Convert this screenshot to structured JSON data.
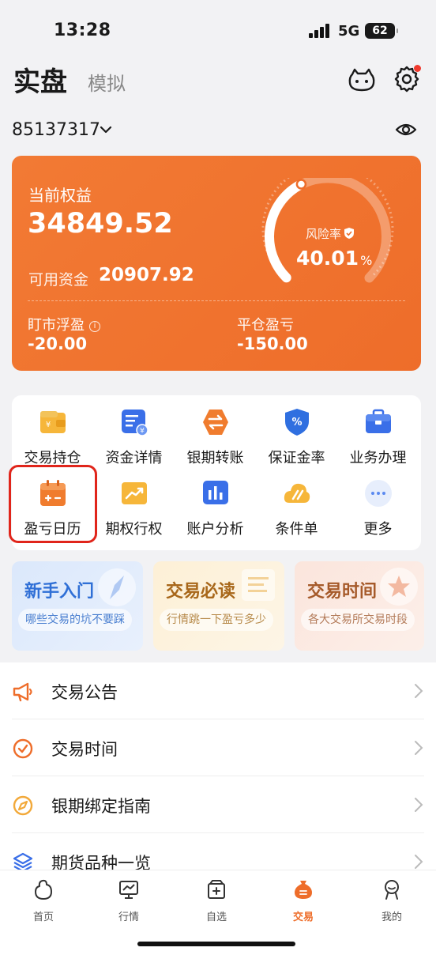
{
  "status": {
    "time": "13:28",
    "network": "5G",
    "battery": "62"
  },
  "header": {
    "tab_real": "实盘",
    "tab_sim": "模拟"
  },
  "account": {
    "number": "85137317"
  },
  "equity": {
    "label": "当前权益",
    "value": "34849.52",
    "available_label": "可用资金",
    "available_value": "20907.92",
    "risk_label": "风险率",
    "risk_value": "40.01",
    "risk_unit": "%",
    "risk_fraction": 0.4001,
    "mtm_label": "盯市浮盈",
    "mtm_value": "-20.00",
    "close_label": "平仓盈亏",
    "close_value": "-150.00"
  },
  "functions": [
    {
      "label": "交易持仓",
      "icon": "wallet-icon"
    },
    {
      "label": "资金详情",
      "icon": "fund-detail-icon"
    },
    {
      "label": "银期转账",
      "icon": "transfer-icon"
    },
    {
      "label": "保证金率",
      "icon": "margin-rate-icon"
    },
    {
      "label": "业务办理",
      "icon": "briefcase-icon"
    },
    {
      "label": "盈亏日历",
      "icon": "calendar-icon"
    },
    {
      "label": "期权行权",
      "icon": "option-exercise-icon"
    },
    {
      "label": "账户分析",
      "icon": "bar-chart-icon"
    },
    {
      "label": "条件单",
      "icon": "cloud-order-icon"
    },
    {
      "label": "更多",
      "icon": "more-icon"
    }
  ],
  "guides": [
    {
      "title": "新手入门",
      "sub": "哪些交易的坑不要踩",
      "title_color": "#2f6fd6",
      "sub_color": "#4a7fd0"
    },
    {
      "title": "交易必读",
      "sub": "行情跳一下盈亏多少",
      "title_color": "#a8671a",
      "sub_color": "#b78a4a"
    },
    {
      "title": "交易时间",
      "sub": "各大交易所交易时段",
      "title_color": "#a65a2a",
      "sub_color": "#b37a58"
    }
  ],
  "list": [
    {
      "label": "交易公告",
      "icon": "megaphone-icon"
    },
    {
      "label": "交易时间",
      "icon": "check-circle-icon"
    },
    {
      "label": "银期绑定指南",
      "icon": "compass-icon"
    },
    {
      "label": "期货品种一览",
      "icon": "layers-icon"
    }
  ],
  "tabbar": [
    {
      "label": "首页",
      "icon": "home-icon"
    },
    {
      "label": "行情",
      "icon": "market-icon"
    },
    {
      "label": "自选",
      "icon": "watchlist-icon"
    },
    {
      "label": "交易",
      "icon": "trade-icon"
    },
    {
      "label": "我的",
      "icon": "profile-icon"
    }
  ],
  "colors": {
    "accent": "#ee6d2a",
    "highlight": "#e0251b"
  }
}
